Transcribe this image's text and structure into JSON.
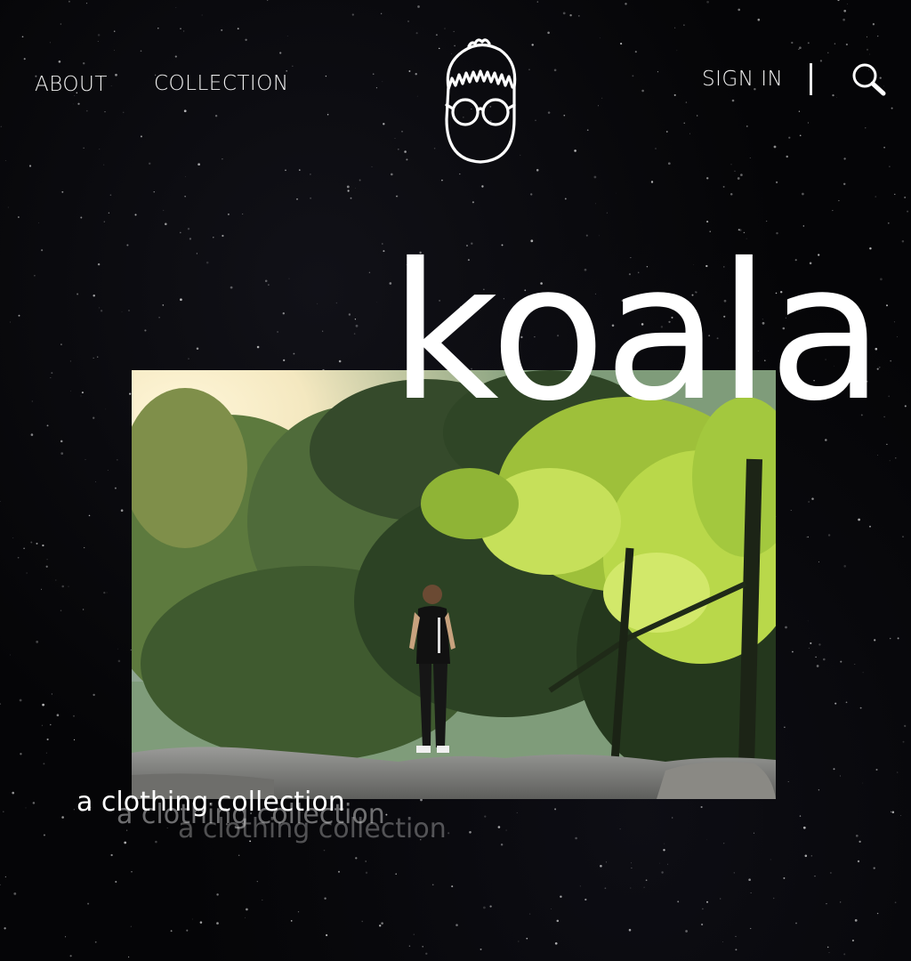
{
  "nav": {
    "about_label": "ABOUT",
    "collection_label": "COLLECTION",
    "signin_label": "SIGN IN",
    "search_icon": "search-icon"
  },
  "logo": {
    "icon": "koala-face-glasses-logo"
  },
  "hero": {
    "brand": "koala",
    "tagline": "a clothing collection",
    "image_subject": "person-standing-on-rock-among-trees"
  },
  "colors": {
    "background": "#050507",
    "text": "#ffffff",
    "foliage_light": "#b9d84a",
    "foliage_dark": "#2f4a22"
  }
}
